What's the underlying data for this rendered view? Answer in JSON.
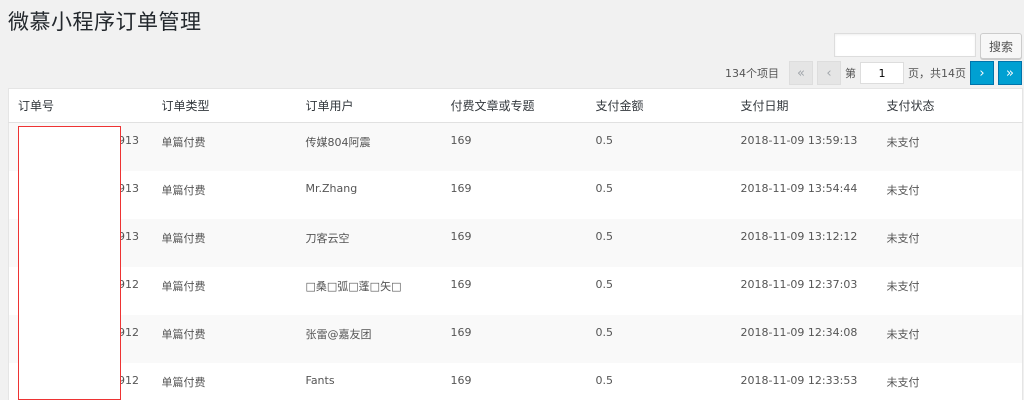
{
  "page": {
    "title": "微慕小程序订单管理"
  },
  "search": {
    "value": "",
    "button_label": "搜索"
  },
  "pagination": {
    "count_label": "134个项目",
    "first": "«",
    "prev": "‹",
    "page_prefix": "第",
    "current_page": "1",
    "page_suffix": "页，共14页",
    "next": "›",
    "last": "»"
  },
  "table": {
    "headers": [
      "订单号",
      "订单类型",
      "订单用户",
      "付费文章或专题",
      "支付金额",
      "支付日期",
      "支付状态"
    ],
    "rows": [
      {
        "order_no": "913",
        "type": "单篇付费",
        "user": "传媒804阿震",
        "post": "169",
        "amount": "0.5",
        "date": "2018-11-09 13:59:13",
        "status": "未支付"
      },
      {
        "order_no": "913",
        "type": "单篇付费",
        "user": "Mr.Zhang",
        "post": "169",
        "amount": "0.5",
        "date": "2018-11-09 13:54:44",
        "status": "未支付"
      },
      {
        "order_no": "913",
        "type": "单篇付费",
        "user": "刀客云空",
        "post": "169",
        "amount": "0.5",
        "date": "2018-11-09 13:12:12",
        "status": "未支付"
      },
      {
        "order_no": "912",
        "type": "单篇付费",
        "user": "□桑□弧□蓬□矢□",
        "post": "169",
        "amount": "0.5",
        "date": "2018-11-09 12:37:03",
        "status": "未支付"
      },
      {
        "order_no": "912",
        "type": "单篇付费",
        "user": "张雷@嘉友团",
        "post": "169",
        "amount": "0.5",
        "date": "2018-11-09 12:34:08",
        "status": "未支付"
      },
      {
        "order_no": "912",
        "type": "单篇付费",
        "user": "Fants",
        "post": "169",
        "amount": "0.5",
        "date": "2018-11-09 12:33:53",
        "status": "未支付"
      }
    ]
  },
  "colors": {
    "accent": "#00a0d2",
    "redaction_border": "#ee3333"
  }
}
